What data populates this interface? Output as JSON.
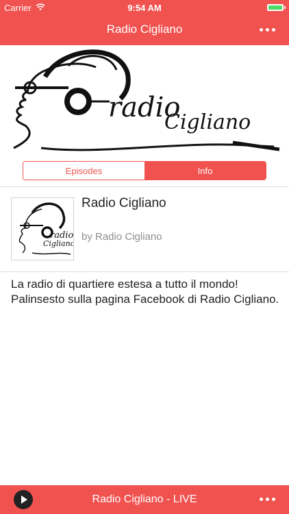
{
  "status_bar": {
    "carrier": "Carrier",
    "time": "9:54 AM",
    "battery_color": "#4cd964"
  },
  "nav": {
    "title": "Radio Cigliano",
    "menu_icon": "more-dots-icon"
  },
  "banner": {
    "logo_text_1": "radio",
    "logo_text_2": "Cigliano"
  },
  "tabs": [
    {
      "label": "Episodes",
      "active": false
    },
    {
      "label": "Info",
      "active": true
    }
  ],
  "podcast": {
    "title": "Radio Cigliano",
    "author": "by Radio Cigliano",
    "thumb_text_1": "radio",
    "thumb_text_2": "Cigliano"
  },
  "description": "La radio di quartiere estesa a tutto il mondo! Palinsesto sulla pagina Facebook di Radio Cigliano.",
  "player": {
    "label": "Radio Cigliano - LIVE",
    "play_icon": "play-icon",
    "menu_icon": "more-dots-icon"
  },
  "colors": {
    "accent": "#f0524f",
    "text": "#222222",
    "secondary_text": "#8e8e8e"
  }
}
